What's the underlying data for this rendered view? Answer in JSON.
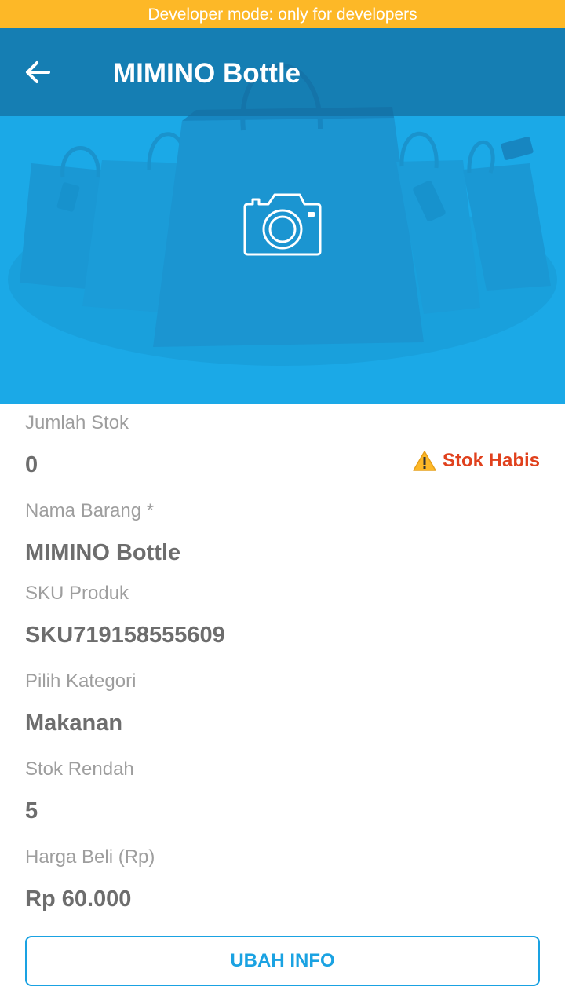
{
  "dev_banner": "Developer mode: only for developers",
  "header": {
    "title": "MIMINO Bottle",
    "back_icon": "arrow-back-icon"
  },
  "hero": {
    "camera_icon": "camera-icon",
    "background_color": "#1ba9e7"
  },
  "fields": {
    "stock": {
      "label": "Jumlah Stok",
      "value": "0"
    },
    "stock_status": {
      "icon": "warning-icon",
      "text": "Stok Habis",
      "color": "#e0411d"
    },
    "name": {
      "label": "Nama Barang *",
      "value": "MIMINO Bottle"
    },
    "sku": {
      "label": "SKU Produk",
      "value": "SKU719158555609"
    },
    "category": {
      "label": "Pilih Kategori",
      "value": "Makanan"
    },
    "low_stock": {
      "label": "Stok Rendah",
      "value": "5"
    },
    "buy_price": {
      "label": "Harga Beli (Rp)",
      "value": "Rp 60.000"
    }
  },
  "actions": {
    "edit_label": "UBAH INFO"
  },
  "colors": {
    "banner": "#fdb827",
    "accent": "#1aa2e2",
    "appbar": "#1d7fae"
  }
}
